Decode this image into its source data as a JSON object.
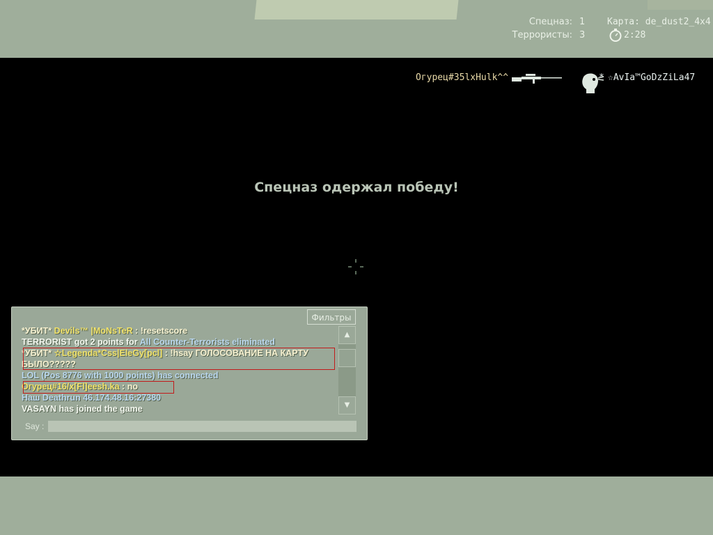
{
  "hud": {
    "ct_label": "Спецназ:",
    "ct_score": "1",
    "t_label": "Террористы:",
    "t_score": "3",
    "map_label": "Карта: de_dust2_4x4",
    "timer": "2:28"
  },
  "killfeed": {
    "attacker": "Огурец#35lxHulk^^",
    "weapon_icon": "sniper-rifle-icon",
    "headshot_icon": "headshot-icon",
    "victim": "☆AvIa™GoDzZiLa47",
    "victim_prefix": "*"
  },
  "center_message": "Спецназ одержал победу!",
  "chat": {
    "filter_label": "Фильтры",
    "say_label": "Say :",
    "say_value": "",
    "lines": [
      {
        "prefix": "*УБИТ*",
        "name": "Devils™ |MoNsTeR",
        "sep": " : ",
        "text": " !resetscore"
      },
      {
        "prefix": "TERRORIST got 2 points for",
        "name": "All Counter-Terrorists eliminated"
      },
      {
        "prefix": "*УБИТ*",
        "name": "☆Legenda*Css|EleGy[pcl]",
        "sep": " : ",
        "text": "!hsay ГОЛОСОВАНИЕ НА КАРТУ",
        "cont": "БЫЛО?????"
      },
      {
        "text": "LOL (Pos 8776 with 1000 points) has connected"
      },
      {
        "name": "Огурец#16/x[Fl]eesh.ka",
        "sep": " : ",
        "text": " no"
      },
      {
        "text": " Наш Deathrun 46.174.48.16:27380"
      },
      {
        "text": "VASAYN has joined the game"
      }
    ]
  }
}
